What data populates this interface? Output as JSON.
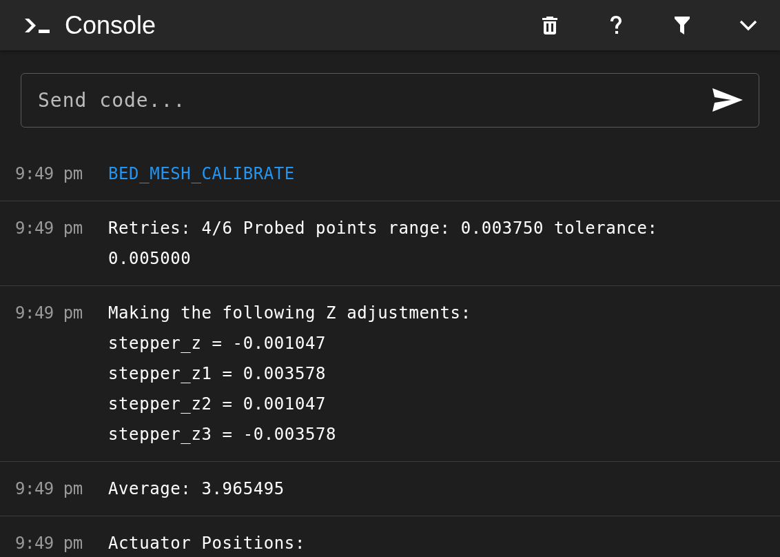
{
  "header": {
    "title": "Console"
  },
  "input": {
    "placeholder": "Send code..."
  },
  "entries": [
    {
      "time": "9:49 pm",
      "kind": "command",
      "lines": [
        "BED_MESH_CALIBRATE"
      ]
    },
    {
      "time": "9:49 pm",
      "kind": "response",
      "lines": [
        "Retries: 4/6 Probed points range: 0.003750 tolerance:",
        "0.005000"
      ]
    },
    {
      "time": "9:49 pm",
      "kind": "response",
      "lines": [
        "Making the following Z adjustments:",
        "stepper_z = -0.001047",
        "stepper_z1 = 0.003578",
        "stepper_z2 = 0.001047",
        "stepper_z3 = -0.003578"
      ]
    },
    {
      "time": "9:49 pm",
      "kind": "response",
      "lines": [
        "Average: 3.965495"
      ]
    },
    {
      "time": "9:49 pm",
      "kind": "response",
      "lines": [
        "Actuator Positions:"
      ]
    }
  ]
}
